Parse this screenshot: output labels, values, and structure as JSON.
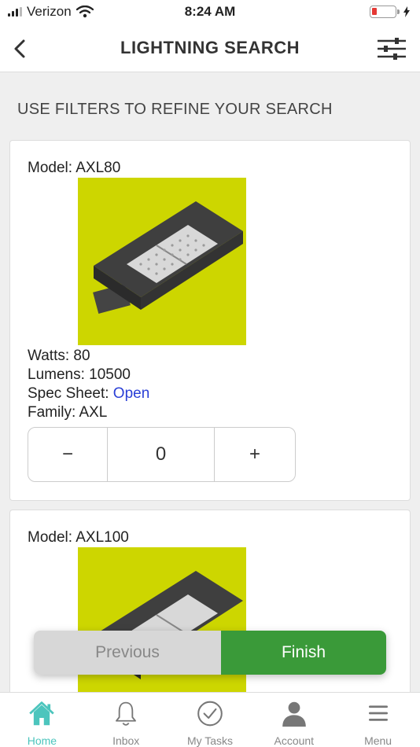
{
  "status_bar": {
    "carrier": "Verizon",
    "time": "8:24 AM",
    "battery_level_pct": 15
  },
  "header": {
    "title": "LIGHTNING SEARCH",
    "back_icon": "chevron-left-icon",
    "filter_icon": "sliders-icon"
  },
  "subtitle": "USE FILTERS TO REFINE YOUR SEARCH",
  "products": [
    {
      "model_label": "Model: AXL80",
      "watts_label": "Watts: 80",
      "lumens_label": "Lumens: 10500",
      "spec_prefix": "Spec Sheet: ",
      "spec_link": "Open",
      "family_label": "Family: AXL",
      "quantity": "0",
      "minus": "−",
      "plus": "+",
      "image_bg": "#cdd600"
    },
    {
      "model_label": "Model: AXL100",
      "image_bg": "#cdd600"
    }
  ],
  "actions": {
    "previous": "Previous",
    "finish": "Finish"
  },
  "tabs": [
    {
      "label": "Home",
      "icon": "home-icon",
      "active": true
    },
    {
      "label": "Inbox",
      "icon": "bell-icon",
      "active": false
    },
    {
      "label": "My Tasks",
      "icon": "check-circle-icon",
      "active": false
    },
    {
      "label": "Account",
      "icon": "user-icon",
      "active": false
    },
    {
      "label": "Menu",
      "icon": "menu-icon",
      "active": false
    }
  ],
  "colors": {
    "accent": "#4cc5bd",
    "finish": "#3a9a39",
    "link": "#2a3fd6",
    "product_bg": "#cdd600"
  }
}
